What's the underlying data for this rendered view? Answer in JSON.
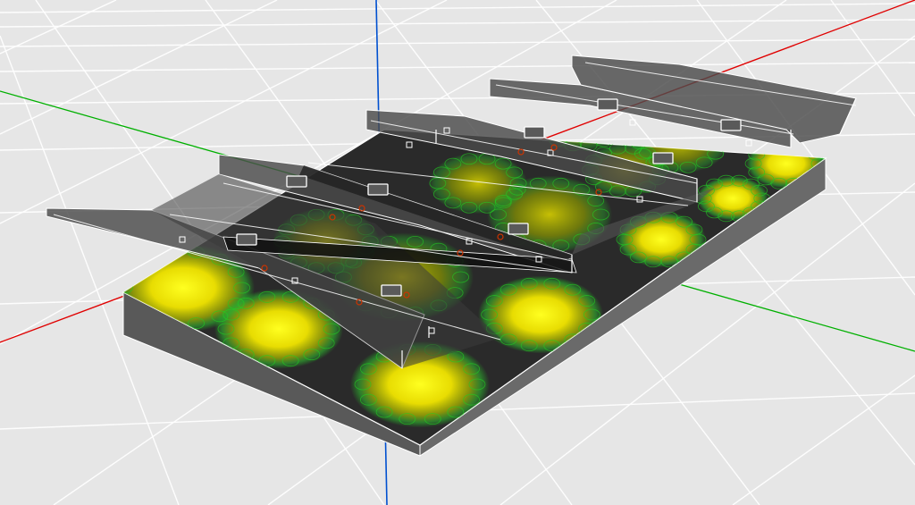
{
  "viewport": {
    "name": "3d-viewport",
    "background": "#e6e6e6",
    "grid_line_color": "#ffffff",
    "axes": {
      "x_color": "#e00000",
      "y_color": "#00b000",
      "z_color": "#0050d0"
    }
  },
  "model": {
    "slab_top_color": "#2a2a2a",
    "slab_side_color": "#5e5e5e",
    "panel_color": "#4b4b4b",
    "edge_color": "#ffffff",
    "heat_inner_color": "#ffff00",
    "heat_mid_color": "#c8c800",
    "heat_ring_color": "#22cc22",
    "marker_color": "#cc3300"
  }
}
